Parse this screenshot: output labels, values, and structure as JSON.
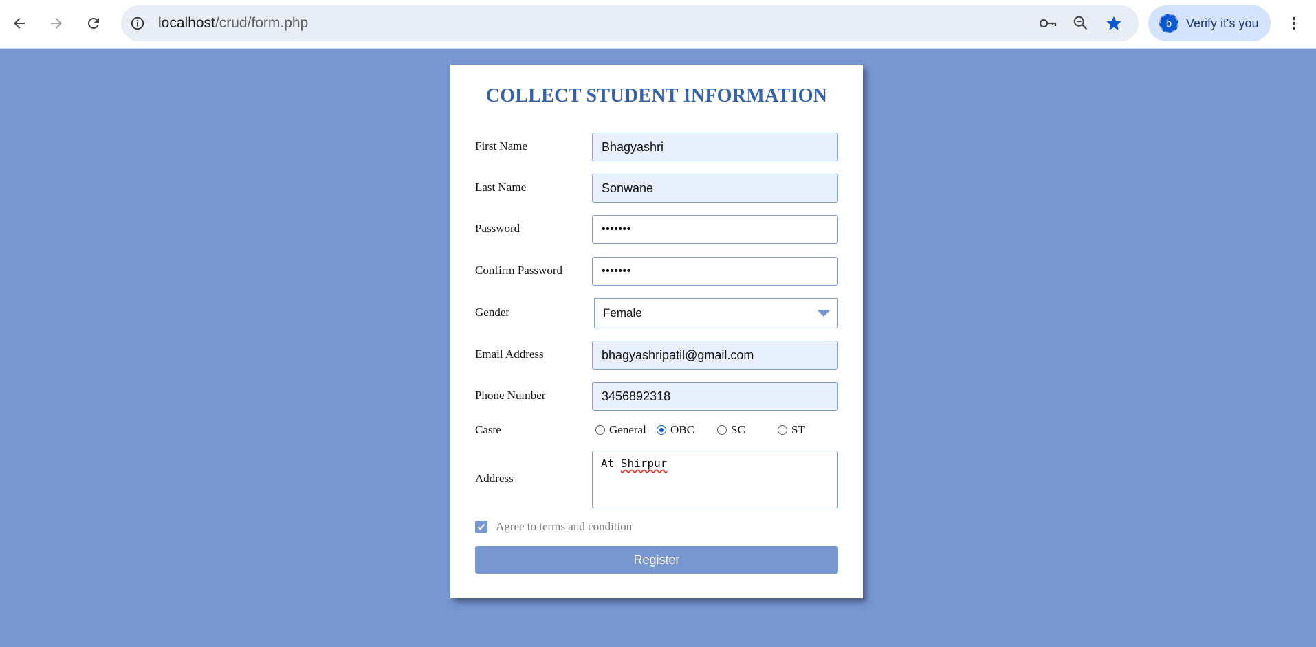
{
  "browser": {
    "url_host": "localhost",
    "url_path": "/crud/form.php",
    "verify_chip_label": "Verify it's you",
    "profile_initial": "b"
  },
  "form": {
    "title": "COLLECT STUDENT INFORMATION",
    "first_name": {
      "label": "First Name",
      "value": "Bhagyashri"
    },
    "last_name": {
      "label": "Last Name",
      "value": "Sonwane"
    },
    "password": {
      "label": "Password",
      "value": "•••••••"
    },
    "confirm_password": {
      "label": "Confirm Password",
      "value": "•••••••"
    },
    "gender": {
      "label": "Gender",
      "value": "Female"
    },
    "email": {
      "label": "Email Address",
      "value": "bhagyashripatil@gmail.com"
    },
    "phone": {
      "label": "Phone Number",
      "value": "3456892318"
    },
    "caste": {
      "label": "Caste",
      "options": [
        "General",
        "OBC",
        "SC",
        "ST"
      ],
      "selected": "OBC"
    },
    "address": {
      "label": "Address",
      "value_prefix": "At ",
      "value_word": "Shirpur"
    },
    "agree": {
      "label": "Agree to terms and condition",
      "checked": true
    },
    "register_label": "Register"
  },
  "colors": {
    "page_background": "#7896cf",
    "title": "#3563ab",
    "accent": "#0b57d0"
  }
}
